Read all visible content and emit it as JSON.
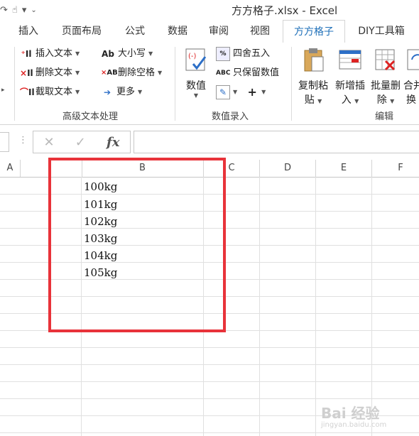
{
  "window": {
    "title": "方方格子.xlsx - Excel"
  },
  "tabs": [
    {
      "label": "插入"
    },
    {
      "label": "页面布局"
    },
    {
      "label": "公式"
    },
    {
      "label": "数据"
    },
    {
      "label": "审阅"
    },
    {
      "label": "视图"
    },
    {
      "label": "方方格子",
      "active": true
    },
    {
      "label": "DIY工具箱"
    }
  ],
  "ribbon": {
    "text_group": {
      "label": "高级文本处理",
      "insert_text": "插入文本",
      "delete_text": "删除文本",
      "extract_text": "截取文本",
      "case": "大小写",
      "delete_spaces": "删除空格",
      "more": "更多"
    },
    "value_group": {
      "label": "数值录入",
      "value_button": "数值",
      "round": "四舍五入",
      "keep_values": "只保留数值"
    },
    "edit_group": {
      "label": "编辑",
      "copy_paste_line1": "复制粘",
      "copy_paste_line2": "贴",
      "insert_new_line1": "新增插",
      "insert_new_line2": "入",
      "batch_delete_line1": "批量删",
      "batch_delete_line2": "除",
      "merge_line1": "合并",
      "merge_line2": "换"
    }
  },
  "formula_bar": {
    "fx": "fx"
  },
  "columns": [
    "A",
    "B",
    "C",
    "D",
    "E",
    "F"
  ],
  "cells": [
    "100kg",
    "101kg",
    "102kg",
    "103kg",
    "104kg",
    "105kg"
  ],
  "watermark": {
    "brand": "Bai 经验",
    "domain": "jingyan.baidu.com"
  },
  "colors": {
    "accent": "#1e6fb8",
    "highlight": "#e8333a"
  }
}
